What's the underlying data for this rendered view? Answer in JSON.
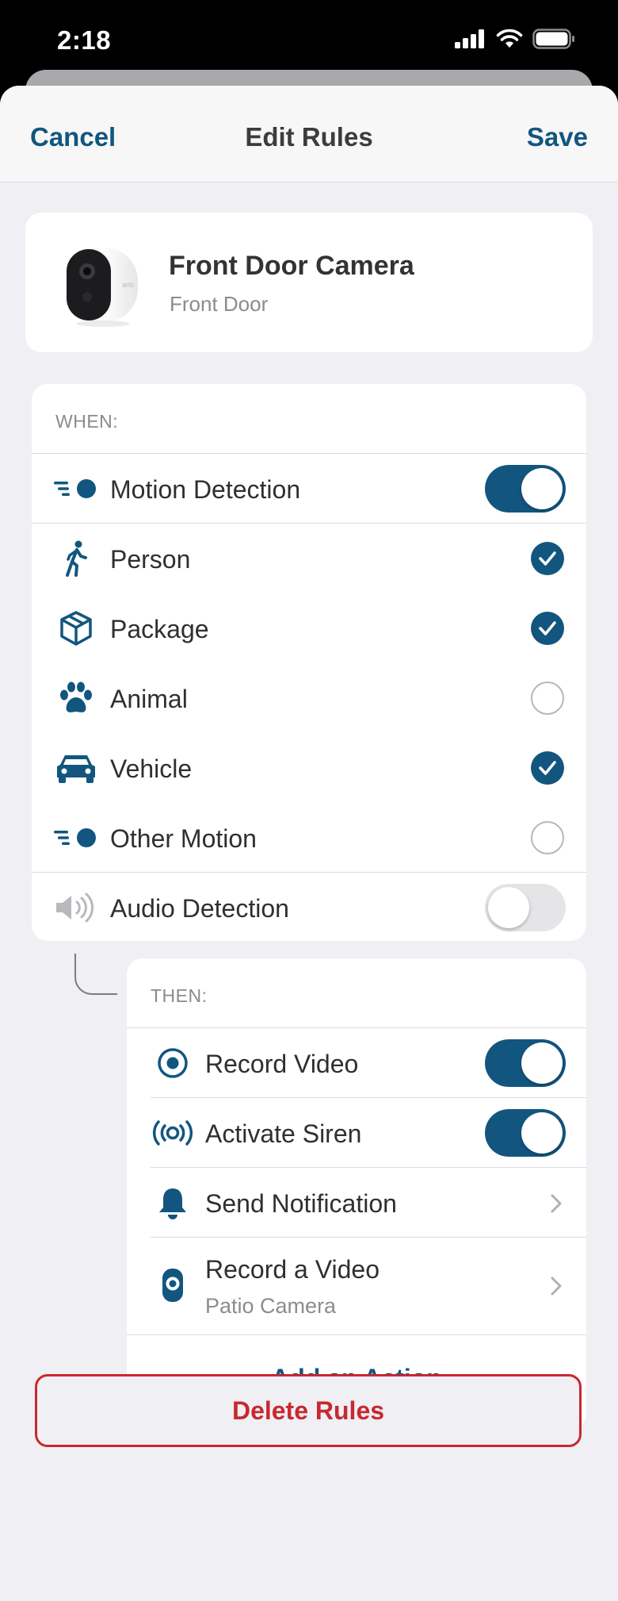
{
  "status_bar": {
    "time": "2:18"
  },
  "nav": {
    "cancel_label": "Cancel",
    "title": "Edit Rules",
    "save_label": "Save"
  },
  "device": {
    "name": "Front Door Camera",
    "location": "Front Door",
    "icon": "camera-thumbnail"
  },
  "when": {
    "header": "WHEN:",
    "motion": {
      "label": "Motion Detection",
      "enabled": true,
      "icon": "motion-icon"
    },
    "types": [
      {
        "label": "Person",
        "checked": true,
        "icon": "person-icon"
      },
      {
        "label": "Package",
        "checked": true,
        "icon": "package-icon"
      },
      {
        "label": "Animal",
        "checked": false,
        "icon": "paw-icon"
      },
      {
        "label": "Vehicle",
        "checked": true,
        "icon": "vehicle-icon"
      },
      {
        "label": "Other Motion",
        "checked": false,
        "icon": "motion-icon"
      }
    ],
    "audio": {
      "label": "Audio Detection",
      "enabled": false,
      "icon": "speaker-icon"
    }
  },
  "then": {
    "header": "THEN:",
    "actions": [
      {
        "label": "Record Video",
        "type": "toggle",
        "enabled": true,
        "icon": "record-icon"
      },
      {
        "label": "Activate Siren",
        "type": "toggle",
        "enabled": true,
        "icon": "siren-icon"
      },
      {
        "label": "Send Notification",
        "type": "link",
        "icon": "bell-icon"
      },
      {
        "label": "Record a Video",
        "sublabel": "Patio Camera",
        "type": "link",
        "icon": "camera-icon"
      }
    ],
    "add_action_label": "Add an Action"
  },
  "delete_label": "Delete Rules",
  "colors": {
    "accent": "#12567f",
    "danger": "#c8282f",
    "background": "#efeff4"
  }
}
